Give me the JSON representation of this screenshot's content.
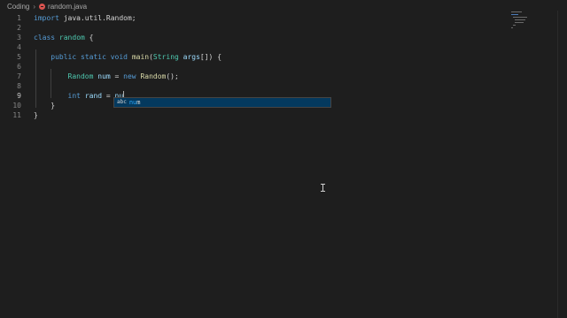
{
  "breadcrumb": {
    "folder": "Coding",
    "file": "random.java"
  },
  "editor": {
    "lines": [
      {
        "n": "1",
        "tokens": [
          [
            "kw",
            "import"
          ],
          [
            "pl",
            " java.util.Random;"
          ]
        ]
      },
      {
        "n": "2",
        "tokens": []
      },
      {
        "n": "3",
        "tokens": [
          [
            "kw",
            "class"
          ],
          [
            "pl",
            " "
          ],
          [
            "ty",
            "random"
          ],
          [
            "pl",
            " {"
          ]
        ]
      },
      {
        "n": "4",
        "tokens": []
      },
      {
        "n": "5",
        "tokens": [
          [
            "pl",
            "    "
          ],
          [
            "kw",
            "public"
          ],
          [
            "pl",
            " "
          ],
          [
            "kw",
            "static"
          ],
          [
            "pl",
            " "
          ],
          [
            "kw",
            "void"
          ],
          [
            "pl",
            " "
          ],
          [
            "fn",
            "main"
          ],
          [
            "pl",
            "("
          ],
          [
            "ty",
            "String"
          ],
          [
            "pl",
            " "
          ],
          [
            "va",
            "args"
          ],
          [
            "pl",
            "[]) {"
          ]
        ]
      },
      {
        "n": "6",
        "tokens": []
      },
      {
        "n": "7",
        "tokens": [
          [
            "pl",
            "        "
          ],
          [
            "ty",
            "Random"
          ],
          [
            "pl",
            " "
          ],
          [
            "va",
            "num"
          ],
          [
            "pl",
            " = "
          ],
          [
            "kw",
            "new"
          ],
          [
            "pl",
            " "
          ],
          [
            "fn",
            "Random"
          ],
          [
            "pl",
            "();"
          ]
        ]
      },
      {
        "n": "8",
        "tokens": []
      },
      {
        "n": "9",
        "tokens": [
          [
            "pl",
            "        "
          ],
          [
            "kw",
            "int"
          ],
          [
            "pl",
            " "
          ],
          [
            "va",
            "rand"
          ],
          [
            "pl",
            " = "
          ],
          [
            "va",
            "nu"
          ]
        ]
      },
      {
        "n": "10",
        "tokens": [
          [
            "pl",
            "    }"
          ]
        ]
      },
      {
        "n": "11",
        "tokens": [
          [
            "pl",
            "}"
          ]
        ]
      }
    ],
    "active_line": "9"
  },
  "suggest": {
    "kind_icon": "abc",
    "match": "nu",
    "rest": "m"
  },
  "colors": {
    "keyword": "#569cd6",
    "type": "#4ec9b0",
    "function": "#dcdcaa",
    "variable": "#9cdcfe",
    "error": "#d9534f",
    "suggest_selected": "#04395e"
  }
}
